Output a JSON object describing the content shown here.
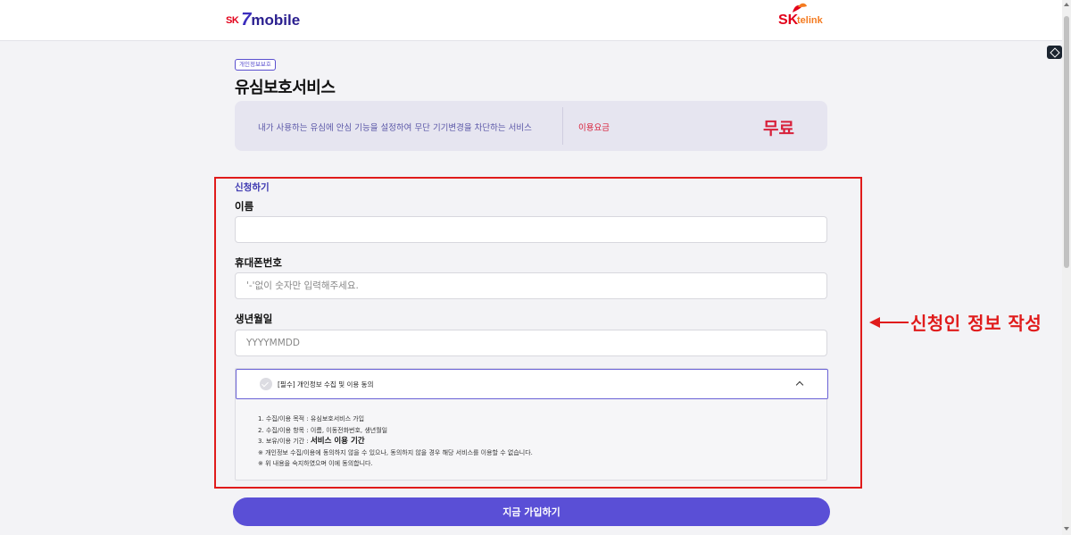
{
  "header": {
    "logo_left": {
      "sk": "SK",
      "seven": "7",
      "mobile": "mobile"
    },
    "logo_right": {
      "sk": "SK",
      "telink": "telink"
    }
  },
  "badge": "개인정보보호",
  "title": "유심보호서비스",
  "info": {
    "description": "내가 사용하는 유심에 안심 기능을 설정하여 무단 기기변경을 차단하는 서비스",
    "fee_label": "이용요금",
    "fee_value": "무료"
  },
  "form": {
    "section_title": "신청하기",
    "name_label": "이름",
    "name_value": "",
    "phone_label": "휴대폰번호",
    "phone_placeholder": "'-'없이 숫자만 입력해주세요.",
    "birth_label": "생년월일",
    "birth_placeholder": "YYYYMMDD"
  },
  "agreement": {
    "title": "[필수] 개인정보 수집 및 이용 동의",
    "line1": "1. 수집/이용 목적 : 유심보호서비스 가입",
    "line2": "2. 수집/이용 항목 : 이름, 이동전화번호, 생년월일",
    "line3_prefix": "3. 보유/이용 기간 : ",
    "line3_strong": "서비스 이용 기간",
    "line4": "※ 개인정보 수집/이용에 동의하지 않을 수 있으나, 동의하지 않을 경우 해당 서비스를 이용할 수 없습니다.",
    "line5": "※ 위 내용을 숙지하였으며 이에 동의합니다."
  },
  "submit_label": "지금 가입하기",
  "annotation": "신청인 정보 작성",
  "colors": {
    "accent": "#5a4fd6",
    "annotation_red": "#e01b1b",
    "fee_red": "#d8203a"
  }
}
